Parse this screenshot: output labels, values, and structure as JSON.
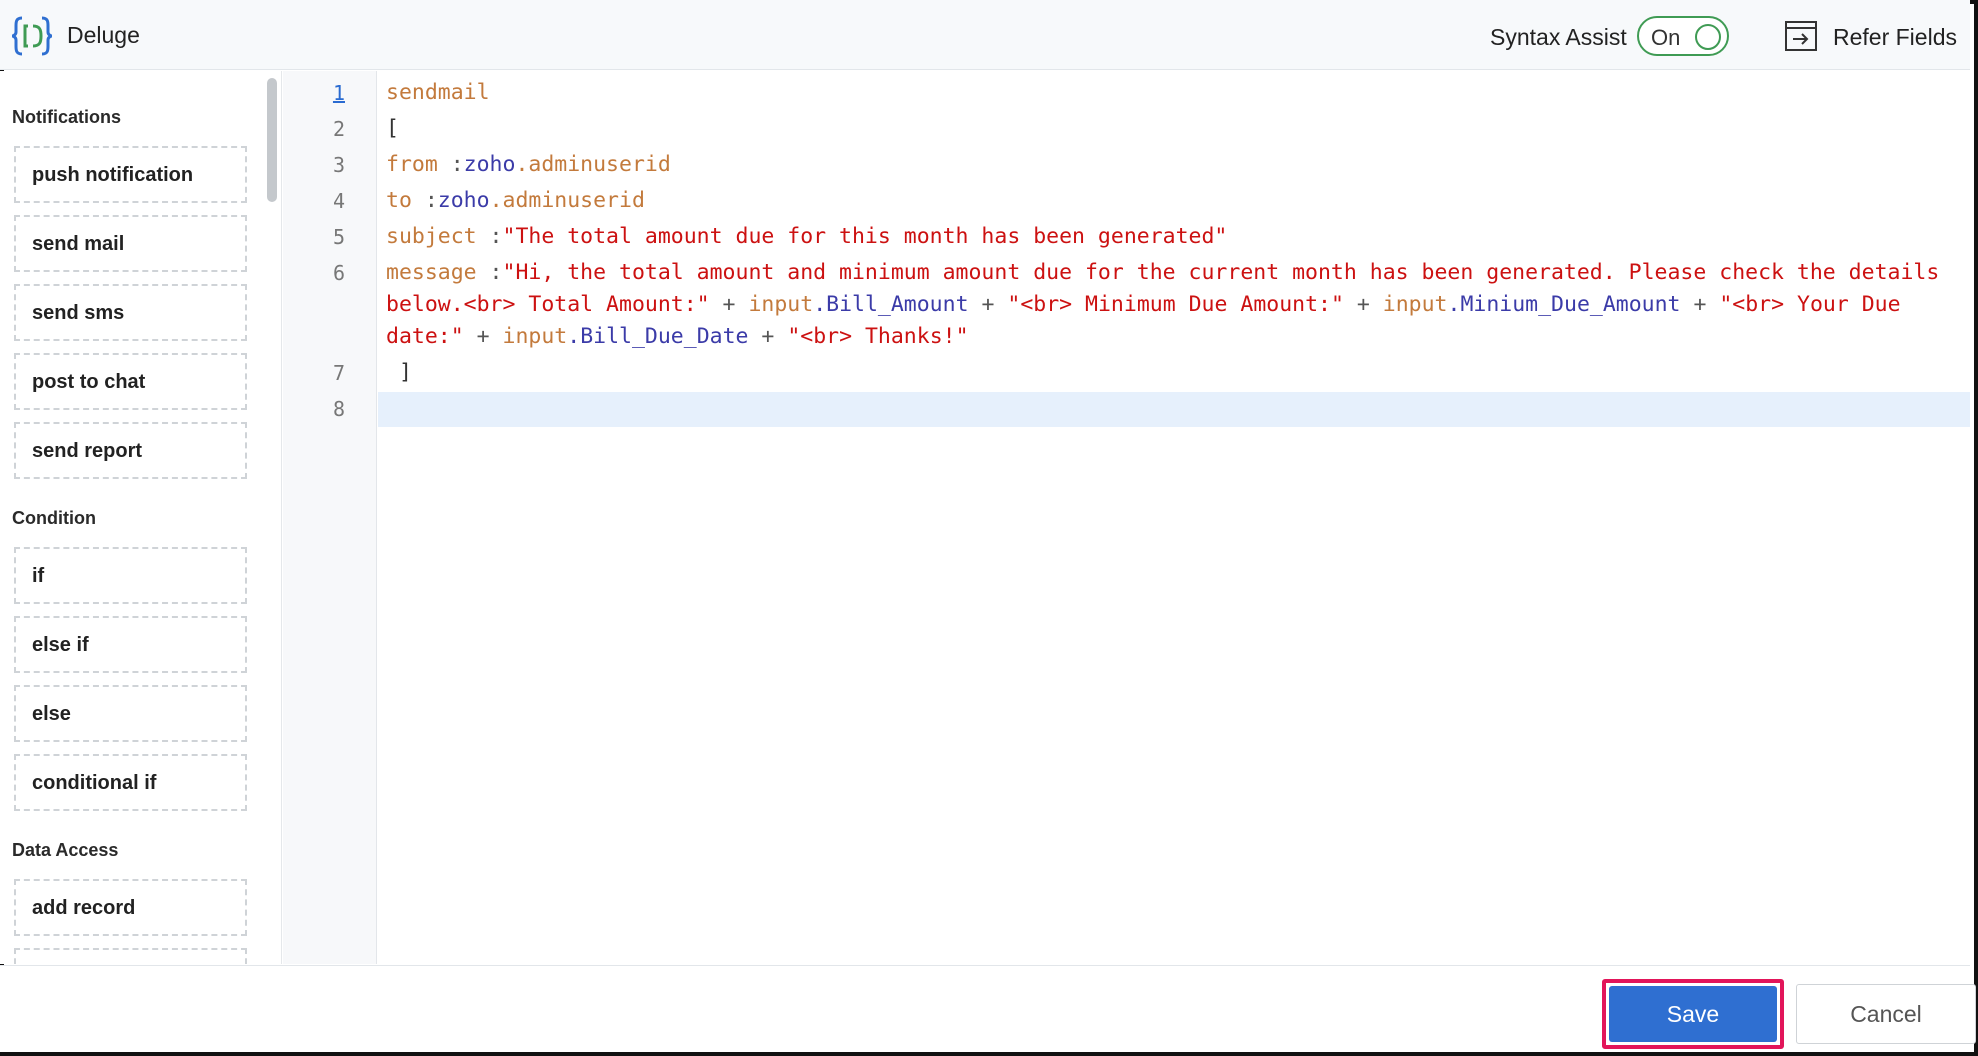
{
  "header": {
    "app_title": "Deluge",
    "syntax_assist_label": "Syntax Assist",
    "syntax_assist_state": "On",
    "refer_fields_label": "Refer Fields"
  },
  "sidebar": {
    "sections": [
      {
        "title": "Notifications",
        "items": [
          "push notification",
          "send mail",
          "send sms",
          "post to chat",
          "send report"
        ]
      },
      {
        "title": "Condition",
        "items": [
          "if",
          "else if",
          "else",
          "conditional if"
        ]
      },
      {
        "title": "Data Access",
        "items": [
          "add record"
        ]
      }
    ]
  },
  "editor": {
    "line_numbers": [
      "1",
      "2",
      "3",
      "4",
      "5",
      "6",
      "7",
      "8"
    ],
    "active_line": "8",
    "lines": {
      "l1": {
        "kw": "sendmail"
      },
      "l2": {
        "text": "["
      },
      "l3": {
        "kw": "from",
        "op": " :",
        "var": "zoho",
        "kw2": ".adminuserid"
      },
      "l4": {
        "kw": "to",
        "op": " :",
        "var": "zoho",
        "kw2": ".adminuserid"
      },
      "l5": {
        "kw": "subject",
        "op": " :",
        "str": "\"The total amount due for this month has been generated\""
      },
      "l6a": {
        "kw": "message",
        "op": " :",
        "str": "\"Hi, the total amount and minimum amount due for the current month has been generated. Please check the details"
      },
      "l6b": {
        "str1": "below.<br> Total Amount:\"",
        "op1": " + ",
        "kw1": "input",
        "var1": ".Bill_Amount",
        "op2": " + ",
        "str2": "\"<br> Minimum Due Amount:\"",
        "op3": " + ",
        "kw2": "input",
        "var2": ".Minium_Due_Amount",
        "op4": " + ",
        "str3": "\"<br> Your Due"
      },
      "l6c": {
        "str1": "date:\"",
        "op1": " + ",
        "kw1": "input",
        "var1": ".Bill_Due_Date",
        "op2": " + ",
        "str2": "\"<br> Thanks!\""
      },
      "l7": {
        "text": " ]"
      }
    }
  },
  "footer": {
    "save_label": "Save",
    "cancel_label": "Cancel"
  },
  "colors": {
    "primary_button": "#2f6fd1",
    "highlight_outline": "#e2155a",
    "toggle_on": "#3f9b54",
    "keyword": "#c37a3c",
    "variable": "#3b3ba8",
    "string": "#cc1111",
    "active_line": "#e6f0fc"
  }
}
